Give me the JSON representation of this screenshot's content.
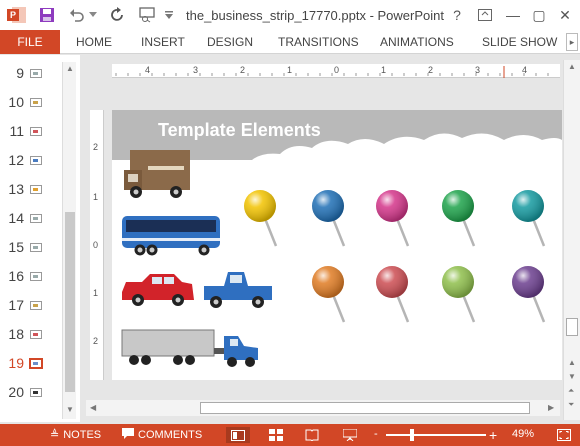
{
  "window": {
    "title": "the_business_strip_17770.pptx - PowerPoint",
    "help_label": "?",
    "min_label": "—",
    "max_label": "▢",
    "close_label": "✕"
  },
  "ribbon": {
    "file_label": "FILE",
    "tabs": [
      "HOME",
      "INSERT",
      "DESIGN",
      "TRANSITIONS",
      "ANIMATIONS",
      "SLIDE SHOW"
    ]
  },
  "slide_panel": {
    "numbers": [
      "9",
      "10",
      "11",
      "12",
      "13",
      "14",
      "15",
      "16",
      "17",
      "18",
      "19",
      "20"
    ],
    "active": "19"
  },
  "ruler": {
    "h_labels": [
      "4",
      "3",
      "2",
      "1",
      "0",
      "1",
      "2",
      "3",
      "4"
    ],
    "v_labels": [
      "2",
      "1",
      "0",
      "1",
      "2"
    ]
  },
  "slide": {
    "title": "Template Elements"
  },
  "colors": {
    "accent": "#d24726",
    "pins": [
      "#f2c300",
      "#1f6fb5",
      "#d4358a",
      "#1ea34b",
      "#159aa0",
      "#e07c24",
      "#cc4d52",
      "#8fbf4c",
      "#6c3f8f"
    ]
  },
  "statusbar": {
    "notes_label": "NOTES",
    "comments_label": "COMMENTS",
    "zoom_minus": "-",
    "zoom_plus": "+",
    "zoom_value": "49%",
    "zoom_level": 0.49
  }
}
